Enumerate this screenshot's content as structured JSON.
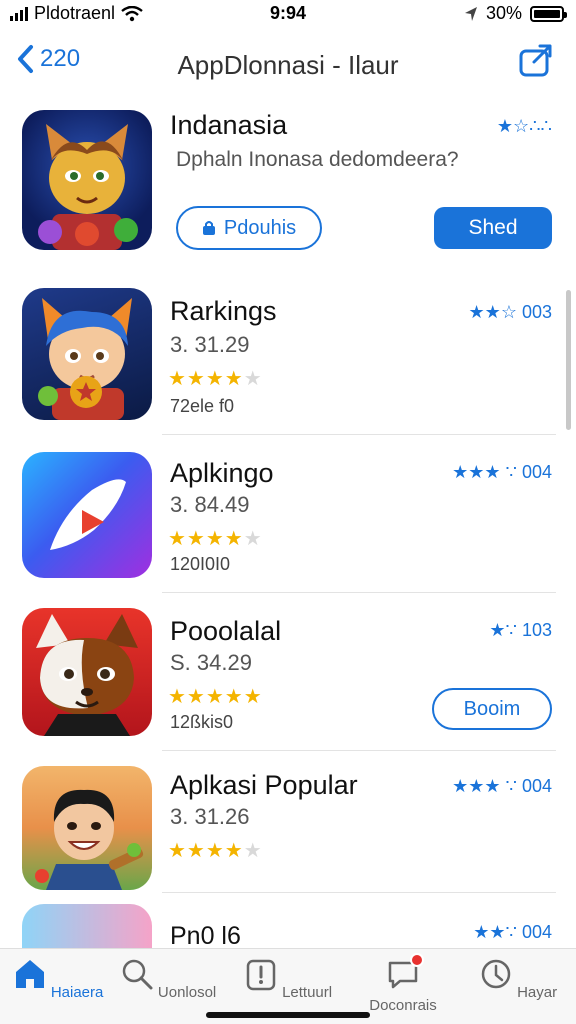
{
  "status_bar": {
    "carrier": "Pldotraenl",
    "time": "9:94",
    "battery_text": "30%"
  },
  "nav": {
    "back_label": "220",
    "title": "AppDlonnasi - Ilaur"
  },
  "featured": {
    "name": "Indanasia",
    "subtitle": "Dphaln Inonasa dedomdeera?",
    "rating_text": "★☆∴∴",
    "outline_button": "Pdouhis",
    "fill_button": "Shed"
  },
  "apps": [
    {
      "name": "Rarkings",
      "version": "3. 31.29",
      "stars_on": "★★★★",
      "stars_off": "★",
      "count": "72ele f0",
      "rating_text": "★★☆ 003"
    },
    {
      "name": "Aplkingo",
      "version": "3. 84.49",
      "stars_on": "★★★★",
      "stars_off": "★",
      "count": "120I0I0",
      "rating_text": "★★★ ∵ 004"
    },
    {
      "name": "Pooolalal",
      "version": "S. 34.29",
      "stars_on": "★★★★★",
      "stars_off": "",
      "count": "12ßkis0",
      "rating_text": "★∵ 103",
      "button": "Booim"
    },
    {
      "name": "Aplkasi Popular",
      "version": "3. 31.26",
      "stars_on": "★★★★",
      "stars_off": "★",
      "count": "",
      "rating_text": "★★★ ∵ 004"
    },
    {
      "name": "Pn0 l6",
      "rating_text": "★★∵ 004"
    }
  ],
  "tabs": [
    {
      "label": "Haiaera",
      "icon": "home-icon"
    },
    {
      "label": "Uonlosol",
      "icon": "search-icon"
    },
    {
      "label": "Lettuurl",
      "icon": "updates-icon"
    },
    {
      "label": "Doconrais",
      "icon": "notifications-icon"
    },
    {
      "label": "Hayar",
      "icon": "account-icon"
    }
  ],
  "colors": {
    "accent": "#1a73d9",
    "star": "#f4b400",
    "badge": "#e8312f"
  }
}
